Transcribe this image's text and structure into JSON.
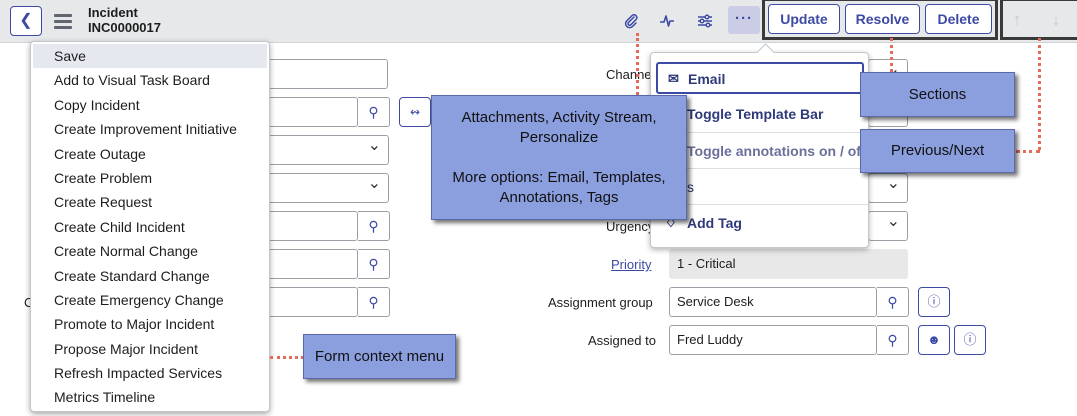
{
  "header": {
    "back_icon": "chevron-left-icon",
    "menu_icon": "hamburger-menu-icon",
    "title": "Incident",
    "number": "INC0000017",
    "icons": [
      "paperclip-icon",
      "activity-stream-icon",
      "personalize-sliders-icon",
      "more-options-icon"
    ],
    "more_label": "···",
    "update_label": "Update",
    "resolve_label": "Resolve",
    "delete_label": "Delete",
    "prev_arrow": "↑",
    "next_arrow": "↓"
  },
  "context_menu": {
    "items": [
      "Save",
      "Add to Visual Task Board",
      "Copy Incident",
      "Create Improvement Initiative",
      "Create Outage",
      "Create Problem",
      "Create Request",
      "Create Child Incident",
      "Create Normal Change",
      "Create Standard Change",
      "Create Emergency Change",
      "Promote to Major Incident",
      "Propose Major Incident",
      "Refresh Impacted Services",
      "Metrics Timeline"
    ],
    "highlighted_index": 0
  },
  "more_menu": {
    "email": "Email",
    "toggle_template_bar": "Toggle Template Bar",
    "toggle_annotations": "Toggle annotations on / off",
    "add_tag": "Add Tag"
  },
  "form": {
    "channel_label": "Channel",
    "urgency_label": "Urgency",
    "priority_label": "Priority",
    "priority_value": "1 - Critical",
    "assignment_group_label": "Assignment group",
    "assignment_group_value": "Service Desk",
    "assigned_to_label": "Assigned to",
    "assigned_to_value": "Fred Luddy",
    "left_label_fragment": "C",
    "state_fragment": "s"
  },
  "callouts": {
    "attachments": "Attachments, Activity Stream, Personalize\n\nMore options: Email, Templates, Annotations, Tags",
    "sections": "Sections",
    "prev_next": "Previous/Next",
    "form_context_menu": "Form context menu"
  },
  "colors": {
    "accent": "#3d4aa3",
    "callout_bg": "#8b9ede",
    "connector": "#e46a5a",
    "header_bg": "#e6e8ea"
  }
}
